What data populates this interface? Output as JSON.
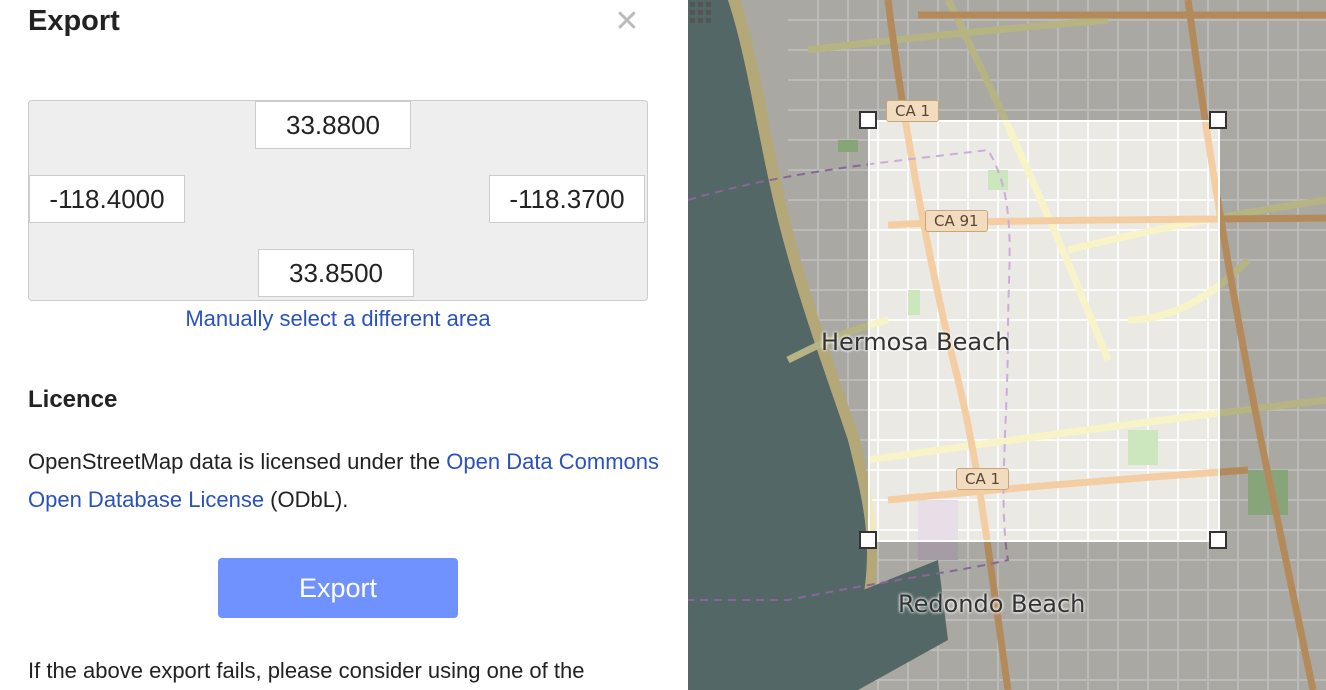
{
  "panel": {
    "title": "Export",
    "close_symbol": "✕"
  },
  "bbox": {
    "north": "33.8800",
    "west": "-118.4000",
    "east": "-118.3700",
    "south": "33.8500",
    "manual_select_label": "Manually select a different area"
  },
  "licence": {
    "heading": "Licence",
    "text_before": "OpenStreetMap data is licensed under the ",
    "link_label": "Open Data Commons Open Database License",
    "text_after": " (ODbL)."
  },
  "export_button_label": "Export",
  "fallback_text": "If the above export fails, please consider using one of the",
  "map": {
    "places": [
      "Hermosa Beach",
      "Redondo Beach"
    ],
    "route_shields": [
      "CA 1",
      "CA 91",
      "CA 1"
    ],
    "colors": {
      "ocean": "#6f8a8a",
      "land": "#e2e0d8",
      "major_road": "#f0b97a",
      "secondary_road": "#f5f0b0",
      "selection": "#ffffff"
    }
  }
}
